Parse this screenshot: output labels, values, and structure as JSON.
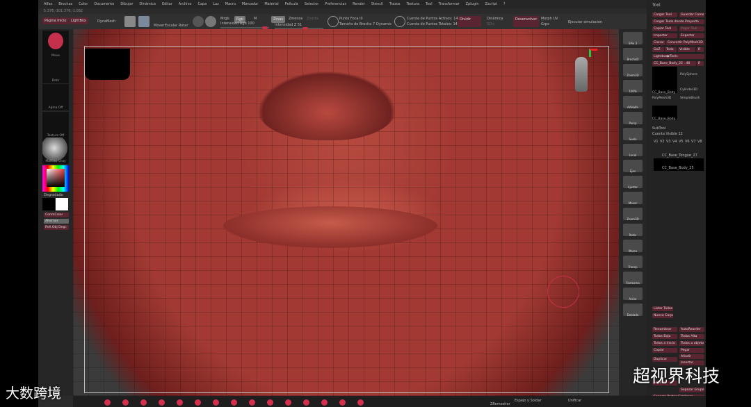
{
  "menu": [
    "Alfas",
    "Brochas",
    "Color",
    "Documento",
    "Dibujar",
    "Dinámica",
    "Editar",
    "Archivo",
    "Capa",
    "Luz",
    "Macro",
    "Marcador",
    "Material",
    "Película",
    "Selector",
    "Preferencias",
    "Render",
    "Stencil",
    "Trazos",
    "Textura",
    "Tool",
    "Transformar",
    "Zplugin",
    "Zscript",
    "?"
  ],
  "coords": "5.376,-101.376,-1.082",
  "shelf": {
    "pagina_inicio": "Página Inicio",
    "lightbox": "LightBox",
    "dynamesh": "DynaMesh",
    "edit": "Edit",
    "dibujar": "Dibujar",
    "mover": "Mover",
    "escalar": "Escalar",
    "rotar": "Rotar",
    "mrgb": "Mrgb",
    "rgb": "Rgb",
    "m": "M",
    "intensidad_rgb": "Intensidad Rgb 100",
    "zmode": "Zmas",
    "zmenos": "Zmenos",
    "zsub": "Zsusta",
    "intensidad_z": "Intensidad Z 51",
    "punto_focal": "Punto Focal 0",
    "tamano": "Tamaño de Brocha 7",
    "dynamic": "Dynamic",
    "activos": "Cuenta de Puntos Activos: 14,",
    "totales": "Cuenta de Puntos Totales: 14,",
    "dividir": "Dividir",
    "dinamica": "Dinámica",
    "subdiv": "SDiv",
    "desenvolver": "Desenvolver",
    "morph_uv": "Morph UV",
    "grps": "Grps",
    "ejecutar": "Ejecutar simulación"
  },
  "left_tray": {
    "brush": "Move",
    "stroke": "Dots",
    "alpha": "Alpha Off",
    "texture": "Texture Off",
    "material": "MatCap Gray",
    "gradient": "Degradado",
    "switch": "ConmColor",
    "alternate": "Alternar",
    "fill": "Rell.Obj Degr."
  },
  "right_shelf": [
    "SPix 3",
    "BrochaD",
    "Zoom3D",
    "100%",
    "AAHalfe",
    "Persp",
    "Suelo",
    "Local",
    "Ejes",
    "Ajustar",
    "Mover",
    "Zoom3D",
    "Rotar",
    "Marco",
    "Transp",
    "Fantasma",
    "Aislar",
    "Doblado"
  ],
  "tool_panel": {
    "title": "Tool",
    "buttons": [
      "Cargar Tool",
      "Guardar Como",
      "Cargar Tools desde Proyecto",
      "Copiar Tool",
      "Pegar Tool",
      "Importar",
      "Exportar",
      "Clonar",
      "Convertir PolyMesh3D",
      "GoZ",
      "Todo",
      "Visible",
      "R",
      "Lightbox▶Tools",
      "CC_Base_Body_25 . 48",
      "R"
    ],
    "tools": [
      "CC_Base_Body",
      "PolySphere",
      "Cylinder3D",
      "PolyMesh3D",
      "SimpleBrush",
      "CC_Base_Body"
    ],
    "subtool": {
      "title": "SubTool",
      "visible": "Cuenta Visible 12",
      "versions": [
        "V1",
        "V2",
        "V3",
        "V4",
        "V5",
        "V6",
        "V7",
        "V8"
      ],
      "items": [
        "CC_Base_Tongue_27",
        "CC_Base_Body_25"
      ]
    },
    "lower": [
      "Listar Todos",
      "Nueva Carpeta",
      "Renombrar",
      "AutoReorder",
      "Todos Baja",
      "Todos Alta",
      "Todos a inicio",
      "Todos a objeto",
      "Copiar",
      "Pegar",
      "Duplicar",
      "Añadir",
      "Insertar",
      "Separar",
      "Separar Grupos",
      "Separar Partes Similares",
      "Separar Partes"
    ]
  },
  "bottom": {
    "zremesher": "ZRemesher",
    "espejo": "Espejo y Soldar",
    "unificar": "Unificar"
  },
  "watermarks": {
    "left": "大数跨境",
    "right": "超视界科技"
  },
  "colors": {
    "accent": "#c2304a",
    "button": "#5a2430",
    "mesh": "#a23a33"
  }
}
